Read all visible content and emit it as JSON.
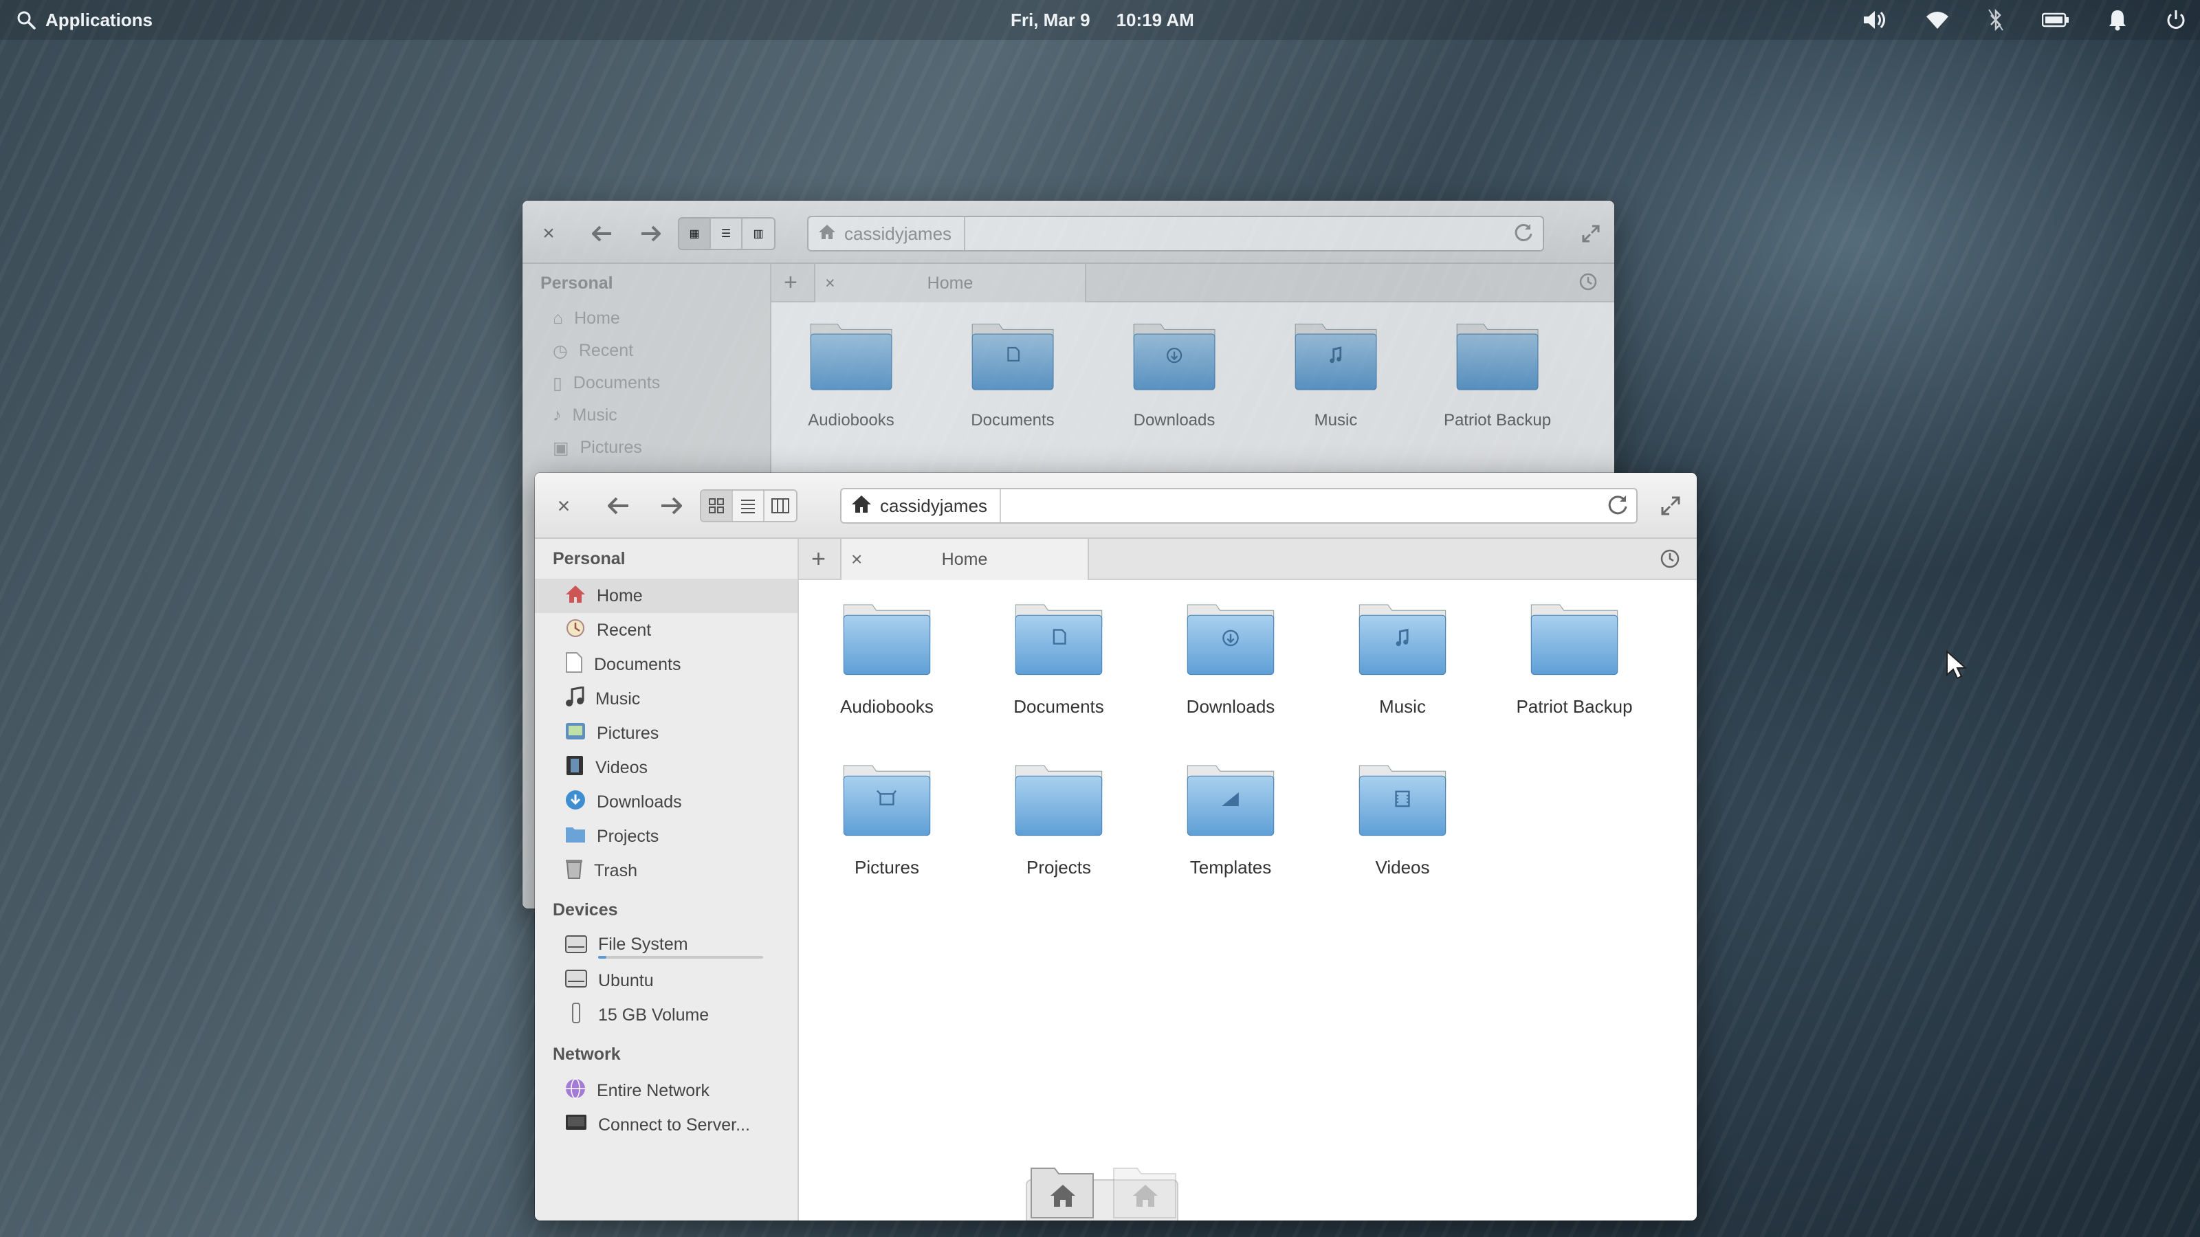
{
  "topbar": {
    "applications_label": "Applications",
    "date": "Fri, Mar 9",
    "time": "10:19 AM",
    "indicators": [
      "volume-icon",
      "wifi-icon",
      "bluetooth-icon",
      "battery-icon",
      "notifications-icon",
      "power-icon"
    ]
  },
  "back_window": {
    "path": "cassidyjames",
    "sidebar_heading": "Personal",
    "sidebar_items": [
      "Home",
      "Recent",
      "Documents",
      "Music",
      "Pictures"
    ],
    "tab_label": "Home",
    "folders": [
      "Audiobooks",
      "Documents",
      "Downloads",
      "Music",
      "Patriot Backup"
    ]
  },
  "front_window": {
    "path": "cassidyjames",
    "tab_label": "Home",
    "sidebar": {
      "personal_heading": "Personal",
      "personal_items": [
        "Home",
        "Recent",
        "Documents",
        "Music",
        "Pictures",
        "Videos",
        "Downloads",
        "Projects",
        "Trash"
      ],
      "devices_heading": "Devices",
      "device_items": [
        "File System",
        "Ubuntu",
        "15 GB Volume"
      ],
      "network_heading": "Network",
      "network_items": [
        "Entire Network",
        "Connect to Server..."
      ]
    },
    "folders": [
      "Audiobooks",
      "Documents",
      "Downloads",
      "Music",
      "Patriot Backup",
      "Pictures",
      "Projects",
      "Templates",
      "Videos"
    ],
    "file_system_usage": 0.05
  },
  "colors": {
    "folder_top": "#a9d0ee",
    "folder_bottom": "#5e9fd6",
    "accent": "#5a9bd5"
  }
}
